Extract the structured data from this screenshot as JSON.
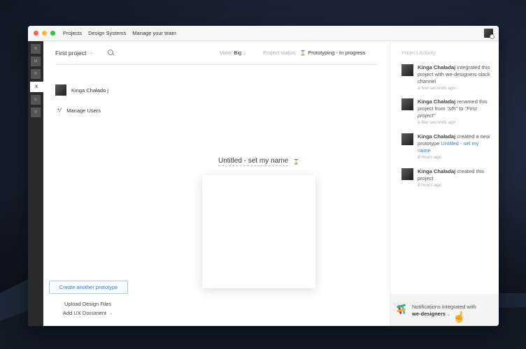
{
  "topnav": [
    "Projects",
    "Design Systems",
    "Manage your team"
  ],
  "leftbar": [
    "B",
    "M",
    "R",
    "K",
    "E",
    "V"
  ],
  "toolbar": {
    "project_name": "First project",
    "view_label": "View:",
    "view_value": "Big",
    "status_label": "Project status:",
    "status_value": "Prototyping - In progress"
  },
  "sidebar": {
    "user_name": "Kinga Chałado j",
    "manage_users": "Manage Users"
  },
  "prototype": {
    "title": "Untitled - set my name"
  },
  "actions": {
    "create": "Create another prototype",
    "upload": "Upload Design Files",
    "ux_doc": "Add UX Document"
  },
  "activity": {
    "heading": "Project Activity",
    "items": [
      {
        "who": "Kinga Chaładaj",
        "pre": "integrated this project with we-designers slack channel",
        "time": "a few seconds ago"
      },
      {
        "who": "Kinga Chaładaj",
        "pre": "renamed this project from",
        "from": "\"sth\"",
        "mid": "to",
        "to": "\"First project\"",
        "time": "a few seconds ago"
      },
      {
        "who": "Kinga Chaładaj",
        "pre": "created a new prototype",
        "link": "Untitled - set my name",
        "time": "8 hours ago"
      },
      {
        "who": "Kinga Chaładaj",
        "pre": "created this project",
        "time": "8 hours ago"
      }
    ]
  },
  "notification": {
    "text": "Notifications integrated with",
    "channel": "we-designers"
  },
  "colors": {
    "accent": "#3a7fd0",
    "sidebar_bg": "#2a2a2a"
  }
}
